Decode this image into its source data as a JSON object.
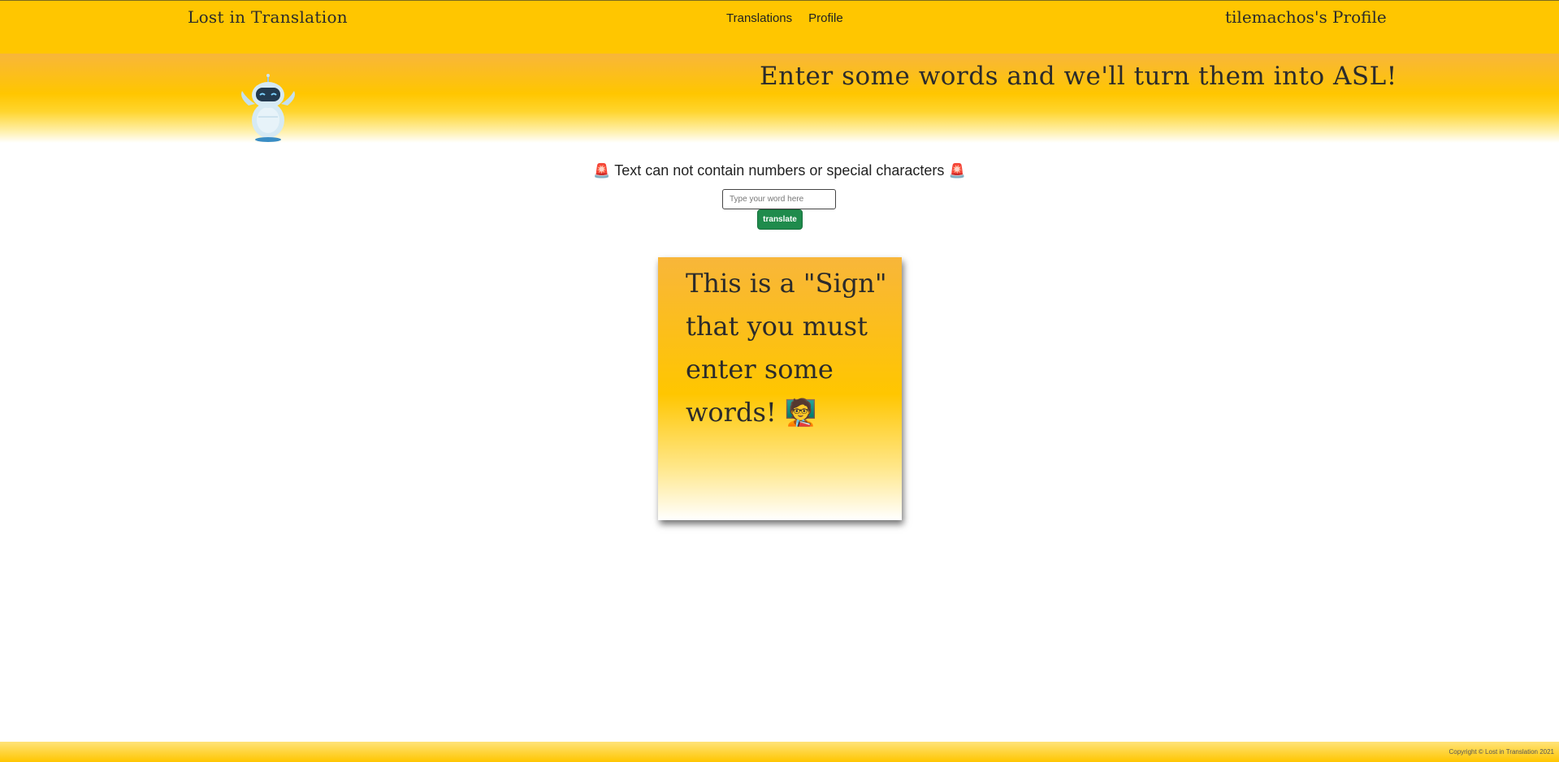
{
  "navbar": {
    "brand": "Lost in Translation",
    "links": [
      {
        "label": "Translations"
      },
      {
        "label": "Profile"
      }
    ],
    "profile": "tilemachos's Profile"
  },
  "hero": {
    "title": "Enter some words and we'll turn them into ASL!",
    "robot_icon": "robot-mascot-icon"
  },
  "form": {
    "warning": "Text can not contain numbers or special characters",
    "warning_icon": "police-light-icon",
    "input_placeholder": "Type your word here",
    "input_value": "",
    "button_label": "translate"
  },
  "sign": {
    "text": "This is a \"Sign\" that you must enter some words!",
    "emoji_icon": "teacher-icon"
  },
  "footer": {
    "copyright": "Copyright © Lost in Translation 2021"
  },
  "colors": {
    "primary": "#ffc600",
    "button": "#1f8b4c"
  }
}
